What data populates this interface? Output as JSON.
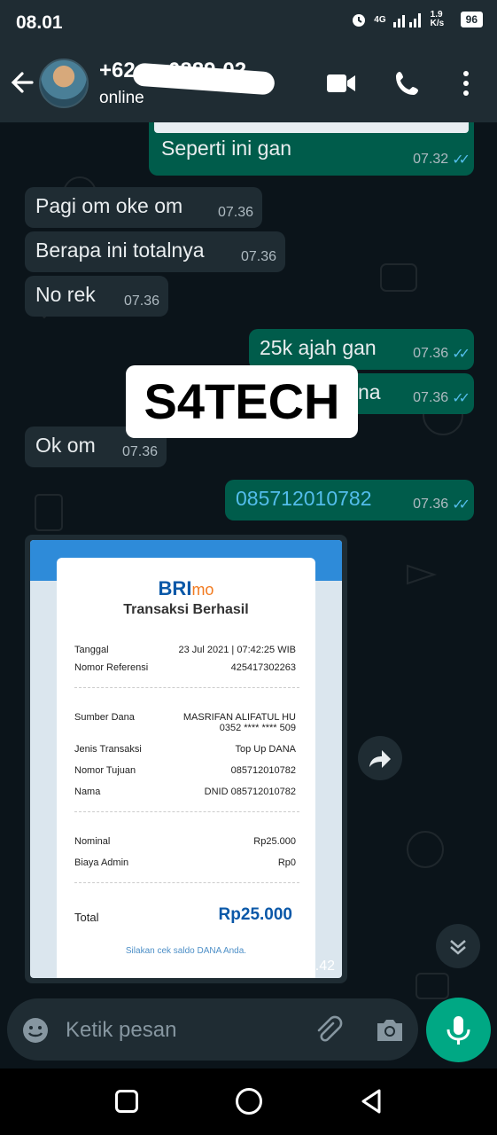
{
  "status_bar": {
    "time": "08.01",
    "network": "4G",
    "speed": "1.9 K/s",
    "battery": "96"
  },
  "header": {
    "contact_name": "+62 ···  0889-02...",
    "contact_status": "online"
  },
  "messages": [
    {
      "text": "Seperti ini gan",
      "time": "07.32"
    },
    {
      "text": "Pagi om oke om",
      "time": "07.36"
    },
    {
      "text": "Berapa ini totalnya",
      "time": "07.36"
    },
    {
      "text": "No rek",
      "time": "07.36"
    },
    {
      "text": "25k ajah gan",
      "time": "07.36"
    },
    {
      "text": "na",
      "time": "07.36"
    },
    {
      "text": "Ok om",
      "time": "07.36"
    },
    {
      "text": "085712010782",
      "time": "07.36"
    }
  ],
  "watermark": "S4TECH",
  "receipt": {
    "logo_main": "BRI",
    "logo_sub": "mo",
    "title": "Transaksi Berhasil",
    "rows": [
      {
        "label": "Tanggal",
        "value": "23 Jul 2021 | 07:42:25 WIB"
      },
      {
        "label": "Nomor Referensi",
        "value": "425417302263"
      },
      {
        "label": "Sumber Dana",
        "value": "MASRIFAN ALIFATUL HU"
      },
      {
        "label": "",
        "value": "0352 **** **** 509"
      },
      {
        "label": "Jenis Transaksi",
        "value": "Top Up DANA"
      },
      {
        "label": "Nomor Tujuan",
        "value": "085712010782"
      },
      {
        "label": "Nama",
        "value": "DNID 085712010782"
      },
      {
        "label": "Nominal",
        "value": "Rp25.000"
      },
      {
        "label": "Biaya Admin",
        "value": "Rp0"
      }
    ],
    "total_label": "Total",
    "total_value": "Rp25.000",
    "note": "Silakan cek saldo DANA Anda.",
    "time": "07.42"
  },
  "input": {
    "placeholder": "Ketik pesan"
  },
  "colors": {
    "header": "#1f2c33",
    "chat_bg": "#0b141a",
    "outgoing": "#005c4b",
    "incoming": "#1f2c33",
    "accent": "#00a884",
    "tick": "#53bdeb"
  }
}
